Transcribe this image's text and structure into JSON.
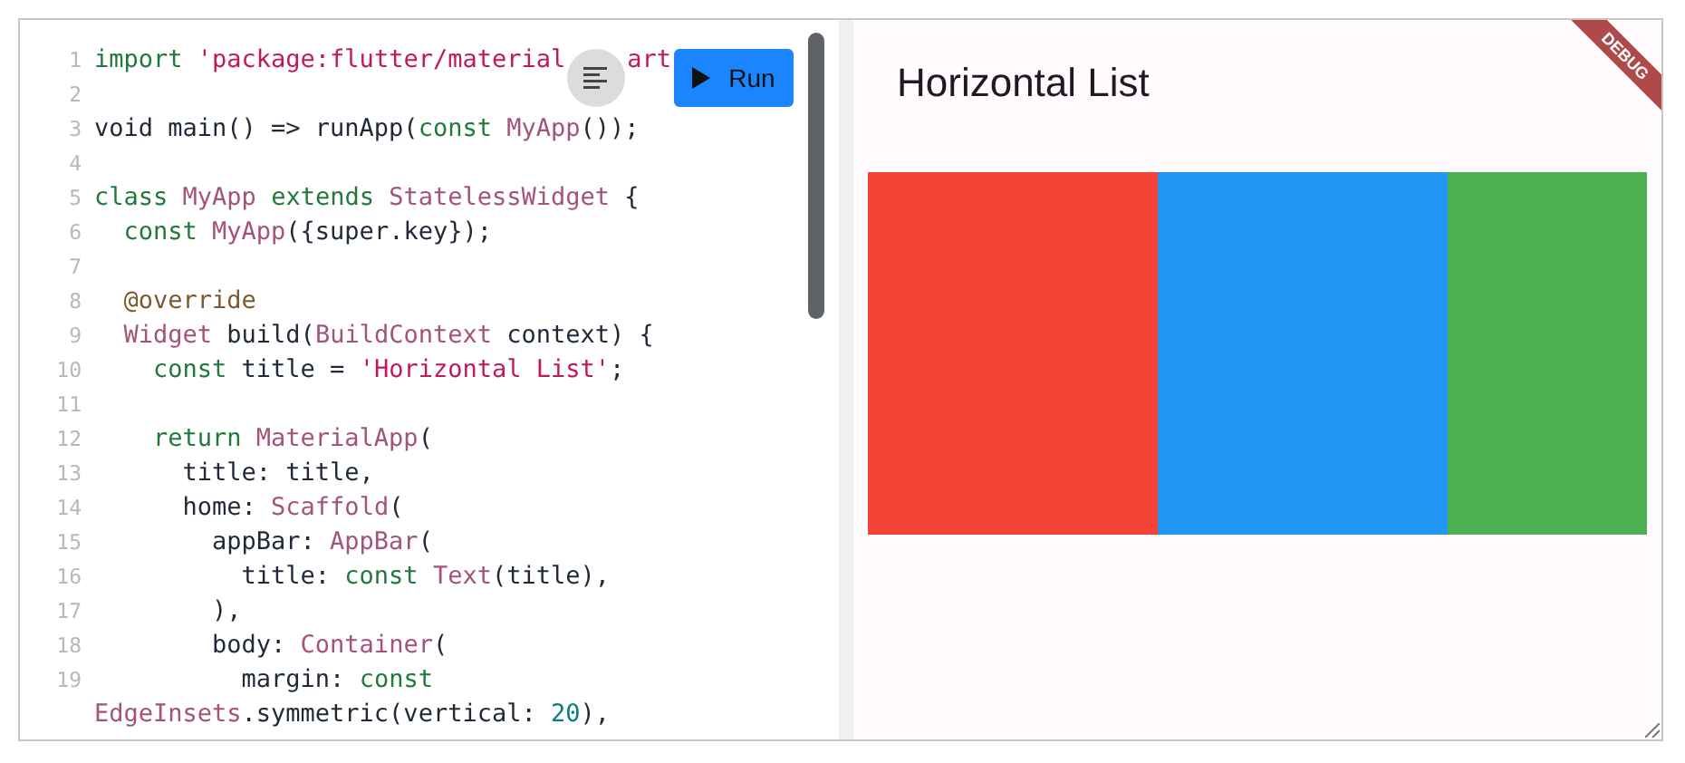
{
  "editor": {
    "lines": [
      {
        "number": "1",
        "tokens": [
          {
            "kind": "keyword",
            "text": "import "
          },
          {
            "kind": "string",
            "text": "'package:flutter/material"
          },
          {
            "kind": "string",
            "text": "art",
            "covered_before": true
          }
        ]
      },
      {
        "number": "2"
      },
      {
        "number": "3",
        "tokens": [
          {
            "kind": "plain",
            "text": "void main() => runApp("
          },
          {
            "kind": "keyword",
            "text": "const "
          },
          {
            "kind": "type",
            "text": "MyApp"
          },
          {
            "kind": "plain",
            "text": "());"
          }
        ]
      },
      {
        "number": "4"
      },
      {
        "number": "5",
        "tokens": [
          {
            "kind": "keyword",
            "text": "class "
          },
          {
            "kind": "type",
            "text": "MyApp "
          },
          {
            "kind": "keyword",
            "text": "extends "
          },
          {
            "kind": "type",
            "text": "StatelessWidget"
          },
          {
            "kind": "plain",
            "text": " {"
          }
        ]
      },
      {
        "number": "6",
        "tokens": [
          {
            "kind": "keyword",
            "text": "  const "
          },
          {
            "kind": "type",
            "text": "MyApp"
          },
          {
            "kind": "plain",
            "text": "({super.key});"
          }
        ]
      },
      {
        "number": "7"
      },
      {
        "number": "8",
        "tokens": [
          {
            "kind": "annotation",
            "text": "  @override"
          }
        ]
      },
      {
        "number": "9",
        "tokens": [
          {
            "kind": "type",
            "text": "  Widget "
          },
          {
            "kind": "plain",
            "text": "build("
          },
          {
            "kind": "type",
            "text": "BuildContext"
          },
          {
            "kind": "plain",
            "text": " context) {"
          }
        ]
      },
      {
        "number": "10",
        "tokens": [
          {
            "kind": "keyword",
            "text": "    const "
          },
          {
            "kind": "plain",
            "text": "title = "
          },
          {
            "kind": "string",
            "text": "'Horizontal List'"
          },
          {
            "kind": "plain",
            "text": ";"
          }
        ]
      },
      {
        "number": "11"
      },
      {
        "number": "12",
        "tokens": [
          {
            "kind": "keyword",
            "text": "    return "
          },
          {
            "kind": "type",
            "text": "MaterialApp"
          },
          {
            "kind": "plain",
            "text": "("
          }
        ]
      },
      {
        "number": "13",
        "tokens": [
          {
            "kind": "plain",
            "text": "      title: title,"
          }
        ]
      },
      {
        "number": "14",
        "tokens": [
          {
            "kind": "plain",
            "text": "      home: "
          },
          {
            "kind": "type",
            "text": "Scaffold"
          },
          {
            "kind": "plain",
            "text": "("
          }
        ]
      },
      {
        "number": "15",
        "tokens": [
          {
            "kind": "plain",
            "text": "        appBar: "
          },
          {
            "kind": "type",
            "text": "AppBar"
          },
          {
            "kind": "plain",
            "text": "("
          }
        ]
      },
      {
        "number": "16",
        "tokens": [
          {
            "kind": "plain",
            "text": "          title: "
          },
          {
            "kind": "keyword",
            "text": "const "
          },
          {
            "kind": "type",
            "text": "Text"
          },
          {
            "kind": "plain",
            "text": "(title),"
          }
        ]
      },
      {
        "number": "17",
        "tokens": [
          {
            "kind": "plain",
            "text": "        ),"
          }
        ]
      },
      {
        "number": "18",
        "tokens": [
          {
            "kind": "plain",
            "text": "        body: "
          },
          {
            "kind": "type",
            "text": "Container"
          },
          {
            "kind": "plain",
            "text": "("
          }
        ]
      },
      {
        "number": "19",
        "tokens": [
          {
            "kind": "plain",
            "text": "          margin: "
          },
          {
            "kind": "keyword",
            "text": "const"
          }
        ]
      },
      {
        "tokens": [
          {
            "kind": "type",
            "text": "EdgeInsets"
          },
          {
            "kind": "plain",
            "text": ".symmetric(vertical: "
          },
          {
            "kind": "number",
            "text": "20"
          },
          {
            "kind": "plain",
            "text": "),"
          }
        ]
      }
    ]
  },
  "toolbar": {
    "run_label": "Run"
  },
  "preview": {
    "title": "Horizontal List",
    "banner": "DEBUG",
    "tiles": [
      {
        "color": "#f44336"
      },
      {
        "color": "#2196f3"
      },
      {
        "color": "#4caf50"
      }
    ]
  }
}
